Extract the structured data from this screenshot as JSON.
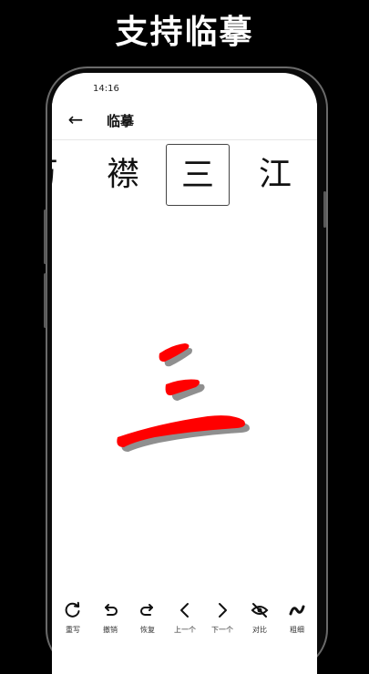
{
  "banner": {
    "title": "支持临摹"
  },
  "status_bar": {
    "time": "14:16"
  },
  "app_bar": {
    "title": "临摹"
  },
  "characters": [
    {
      "char": "万"
    },
    {
      "char": "襟"
    },
    {
      "char": "三",
      "selected": true
    },
    {
      "char": "江"
    }
  ],
  "practice_char": "三",
  "stroke_color": "#ff0000",
  "toolbar": {
    "items": [
      {
        "icon": "rewrite-icon",
        "label": "重写"
      },
      {
        "icon": "undo-icon",
        "label": "撤销"
      },
      {
        "icon": "redo-icon",
        "label": "恢复"
      },
      {
        "icon": "chevron-left-icon",
        "label": "上一个"
      },
      {
        "icon": "chevron-right-icon",
        "label": "下一个"
      },
      {
        "icon": "eye-off-icon",
        "label": "对比"
      },
      {
        "icon": "brush-icon",
        "label": "粗细"
      }
    ]
  }
}
